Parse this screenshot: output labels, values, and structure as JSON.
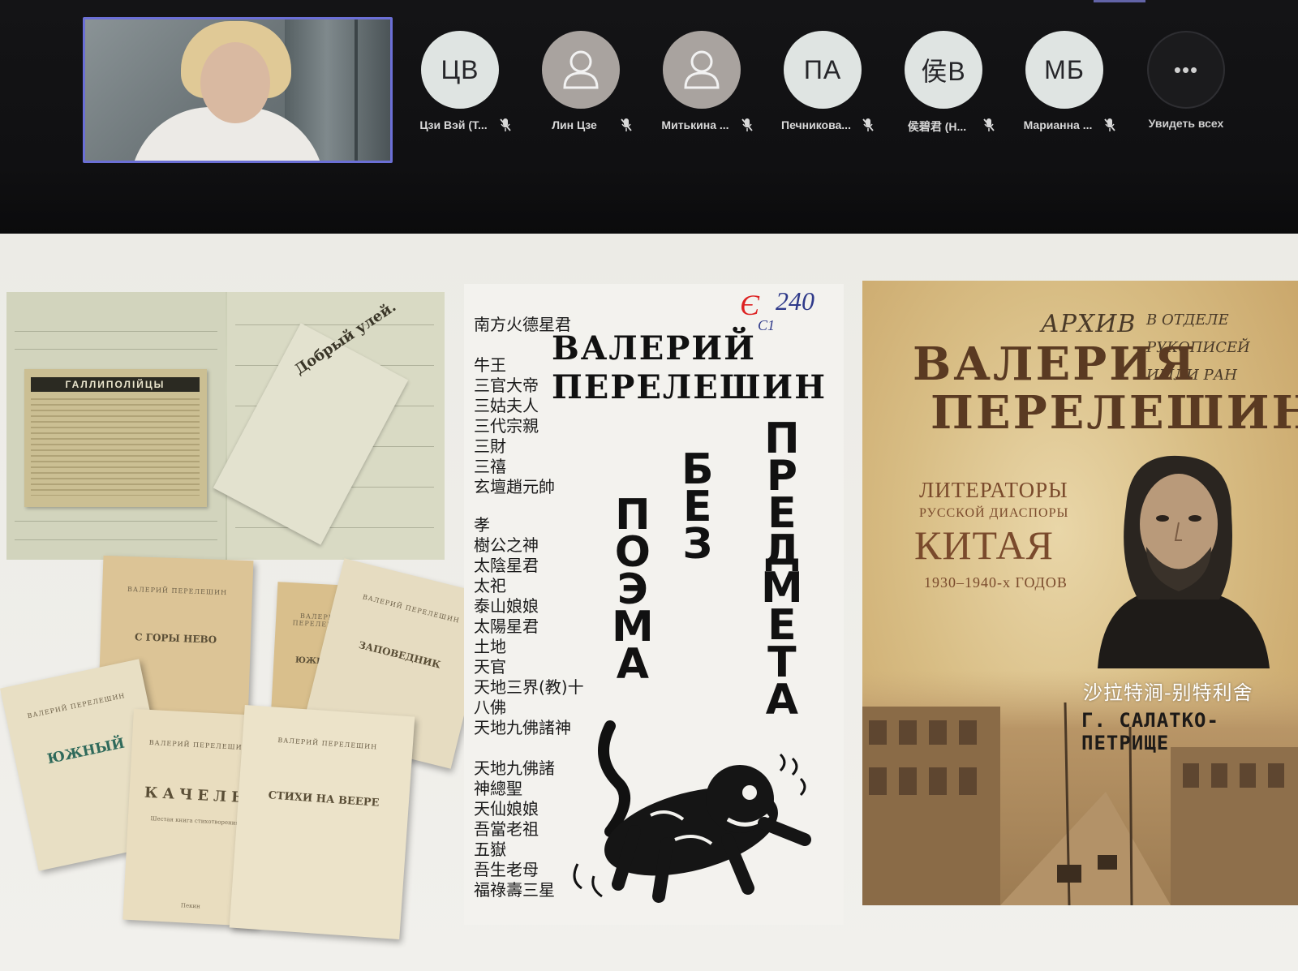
{
  "call": {
    "participants": [
      {
        "initials": "ЦВ",
        "name": "Цзи Вэй (Т...",
        "kind": "initials"
      },
      {
        "initials": "",
        "name": "Лин Цзе",
        "kind": "generic"
      },
      {
        "initials": "",
        "name": "Митькина ...",
        "kind": "generic"
      },
      {
        "initials": "ПА",
        "name": "Печникова...",
        "kind": "initials"
      },
      {
        "initials": "侯B",
        "name": "侯碧君 (Н...",
        "kind": "initials"
      },
      {
        "initials": "МБ",
        "name": "Марианна ...",
        "kind": "initials"
      }
    ],
    "more": {
      "icon": "•••",
      "label": "Увидеть всех"
    },
    "accent_color": "#6b6fd6"
  },
  "slide": {
    "notebook": {
      "clipping_header": "ГАЛЛИПОЛІЙЦЫ",
      "paper_title": "Добрый улей."
    },
    "booklets": {
      "author": "ВАЛЕРИЙ ПЕРЕЛЕШИН",
      "titles": [
        "С ГОРЫ НЕВО",
        "ЮЖНЫЙ",
        "ЗАПОВЕДНИК",
        "ЮЖНЫЙ",
        "КАЧЕЛЬ",
        "СТИХИ НА ВЕЕРЕ"
      ],
      "kachel_sub": "Шестая книга стихотворений",
      "city": "Пекин"
    },
    "poema": {
      "price": "240",
      "price_struck": "Є",
      "price_mark": "С1",
      "poet_line1": "ВАЛЕРИЙ",
      "poet_line2": "ПЕРЕЛЕШИН",
      "word1": "ПОЭМА",
      "word2": "БЕЗ",
      "word3": "ПРЕДМЕТА",
      "deities_top": [
        "南方火德星君",
        "",
        "牛王",
        "三官大帝",
        "三姑夫人",
        "三代宗親",
        "三財",
        "三禧",
        "玄壇趙元帥"
      ],
      "deities_bottom": [
        "孝",
        "樹公之神",
        "太陰星君",
        "太祀",
        "泰山娘娘",
        "太陽星君",
        "土地",
        "天官",
        "天地三界(教)十",
        "八佛",
        "天地九佛諸神",
        "",
        "天地九佛諸",
        "神總聖",
        "天仙娘娘",
        "吾當老祖",
        "五嶽",
        "吾生老母",
        "福祿壽三星"
      ]
    },
    "archive": {
      "archive_label": "АРХИВ",
      "archive_side": [
        "В ОТДЕЛЕ",
        "РУКОПИСЕЙ",
        "ИМЛИ РАН"
      ],
      "name_line1": "ВАЛЕРИЯ",
      "name_line2": "ПЕРЕЛЕШИНА",
      "series1": "ЛИТЕРАТОРЫ",
      "series2": "РУССКОЙ ДИАСПОРЫ",
      "series3": "КИТАЯ",
      "series4": "1930–1940-х ГОДОВ",
      "author_cn": "沙拉特涧-别特利舍",
      "author_ru": "Г. САЛАТКО-ПЕТРИЩЕ"
    }
  }
}
